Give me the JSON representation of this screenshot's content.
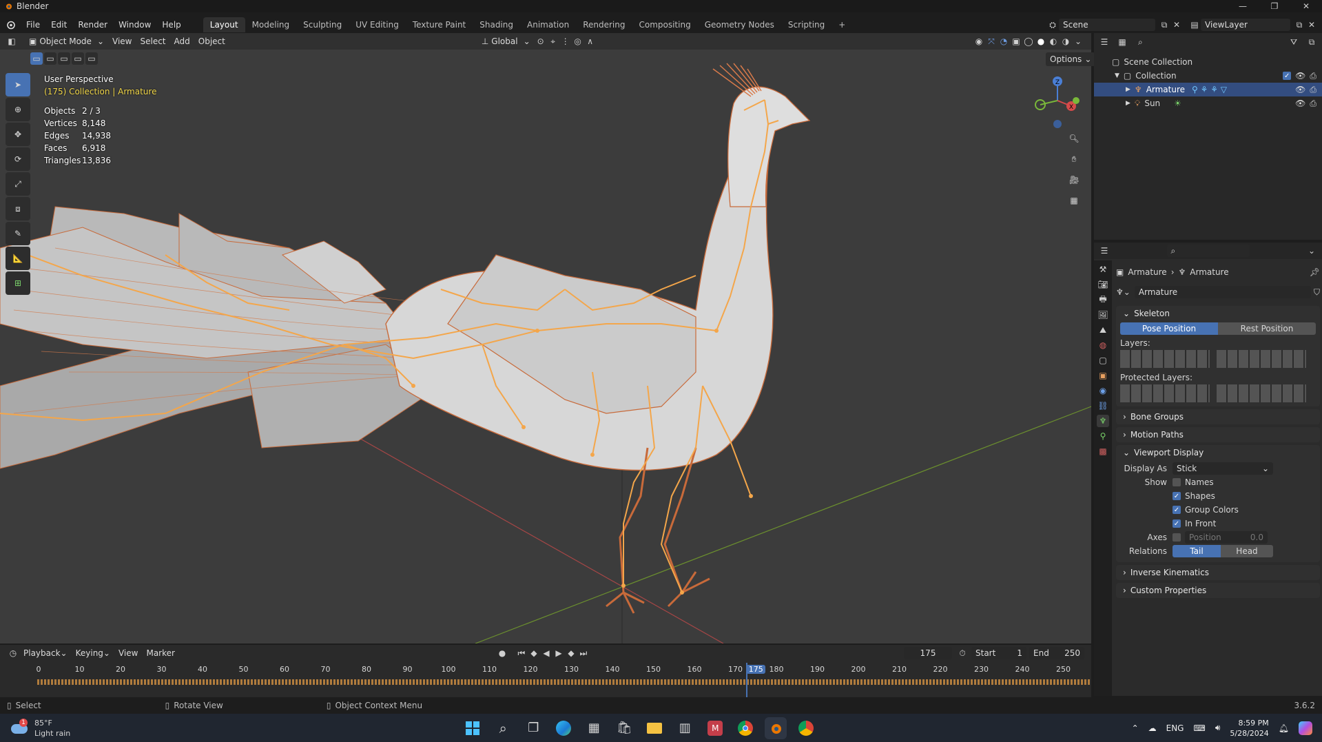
{
  "window": {
    "title": "Blender"
  },
  "menu": [
    "File",
    "Edit",
    "Render",
    "Window",
    "Help"
  ],
  "workspaces": [
    "Layout",
    "Modeling",
    "Sculpting",
    "UV Editing",
    "Texture Paint",
    "Shading",
    "Animation",
    "Rendering",
    "Compositing",
    "Geometry Nodes",
    "Scripting"
  ],
  "scene": {
    "name": "Scene",
    "view_layer": "ViewLayer"
  },
  "viewport_header": {
    "mode": "Object Mode",
    "menus": [
      "View",
      "Select",
      "Add",
      "Object"
    ],
    "orientation": "Global",
    "options_label": "Options"
  },
  "overlay": {
    "view_name": "User Perspective",
    "context": "(175) Collection | Armature",
    "stats": [
      {
        "label": "Objects",
        "value": "2 / 3"
      },
      {
        "label": "Vertices",
        "value": "8,148"
      },
      {
        "label": "Edges",
        "value": "14,938"
      },
      {
        "label": "Faces",
        "value": "6,918"
      },
      {
        "label": "Triangles",
        "value": "13,836"
      }
    ]
  },
  "outliner": {
    "root": "Scene Collection",
    "collection": "Collection",
    "items": [
      "Armature",
      "Sun"
    ]
  },
  "properties": {
    "breadcrumb": [
      "Armature",
      "Armature"
    ],
    "data_name": "Armature",
    "skeleton": {
      "title": "Skeleton",
      "pose_position": "Pose Position",
      "rest_position": "Rest Position",
      "layers_label": "Layers:",
      "protected_label": "Protected Layers:"
    },
    "collapsed_panels_top": [
      "Bone Groups",
      "Motion Paths"
    ],
    "viewport_display": {
      "title": "Viewport Display",
      "display_as_label": "Display As",
      "display_as_value": "Stick",
      "show_label": "Show",
      "show_options": [
        {
          "label": "Names",
          "checked": false
        },
        {
          "label": "Shapes",
          "checked": true
        },
        {
          "label": "Group Colors",
          "checked": true
        },
        {
          "label": "In Front",
          "checked": true
        }
      ],
      "axes_label": "Axes",
      "position_label": "Position",
      "position_value": "0.0",
      "relations_label": "Relations",
      "tail": "Tail",
      "head": "Head"
    },
    "collapsed_panels_bottom": [
      "Inverse Kinematics",
      "Custom Properties"
    ]
  },
  "timeline": {
    "menus": [
      "Playback",
      "Keying",
      "View",
      "Marker"
    ],
    "current_frame": "175",
    "start_label": "Start",
    "start_value": "1",
    "end_label": "End",
    "end_value": "250",
    "ticks": [
      "0",
      "10",
      "20",
      "30",
      "40",
      "50",
      "60",
      "70",
      "80",
      "90",
      "100",
      "110",
      "120",
      "130",
      "140",
      "150",
      "160",
      "170",
      "175",
      "180",
      "190",
      "200",
      "210",
      "220",
      "230",
      "240",
      "250"
    ]
  },
  "statusbar": {
    "items": [
      "Select",
      "Rotate View",
      "Object Context Menu"
    ],
    "version": "3.6.2"
  },
  "taskbar": {
    "weather_temp": "85°F",
    "weather_desc": "Light rain",
    "weather_badge": "1",
    "lang": "ENG",
    "time": "8:59 PM",
    "date": "5/28/2024"
  },
  "colors": {
    "accent": "#4772b3",
    "selection": "#f4a64a",
    "grid_x": "#b04a4a",
    "grid_y": "#6b8f2e"
  }
}
